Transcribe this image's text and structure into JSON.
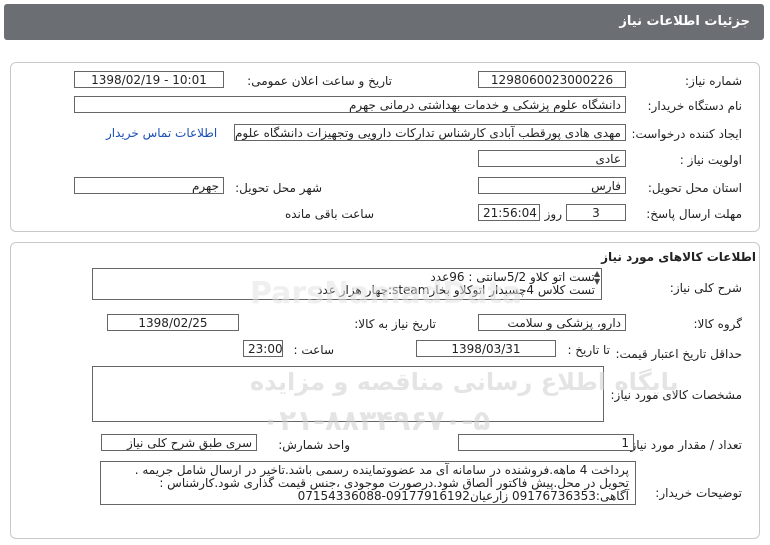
{
  "window_title": "جزئیات اطلاعات نیاز",
  "info": {
    "need_number_label": "شماره نیاز:",
    "need_number": "1298060023000226",
    "announce_label": "تاریخ و ساعت اعلان عمومی:",
    "announce_value": "1398/02/19 - 10:01",
    "buyer_label": "نام دستگاه خریدار:",
    "buyer_value": "دانشگاه علوم پزشکی و خدمات بهداشتی درمانی جهرم",
    "requester_label": "ایجاد کننده درخواست:",
    "requester_value": "مهدی هادی پورقطب آبادی کارشناس تدارکات دارویی وتجهیزات دانشگاه علوم پز",
    "contact_link": "اطلاعات تماس خریدار",
    "priority_label": "اولویت نیاز :",
    "priority_value": "عادی",
    "province_label": "استان محل تحویل:",
    "province_value": "فارس",
    "city_label": "شهر محل تحویل:",
    "city_value": "جهرم",
    "deadline_label": "مهلت ارسال پاسخ:",
    "deadline_days": "3",
    "days_word": "روز و",
    "deadline_time": "21:56:04",
    "remaining_text": "ساعت باقی مانده"
  },
  "goods": {
    "section_title": "اطلاعات کالاهای مورد نیاز",
    "desc_label": "شرح کلی نیاز:",
    "desc_lines": [
      "تست اتو کلاو 5/2سانتی :   96عدد",
      "تست کلاس 4چسبدار اتوکلاو بخارsteam:چهار هزار عدد"
    ],
    "group_label": "گروه کالا:",
    "group_value": "دارو، پزشکی و سلامت",
    "need_date_label": "تاریخ نیاز به کالا:",
    "need_date_value": "1398/02/25",
    "min_price_label": "حداقل تاریخ اعتبار قیمت:",
    "until_date_label": "تا تاریخ :",
    "until_date_value": "1398/03/31",
    "time_label": "ساعت :",
    "time_value": "23:00",
    "specs_label": "مشخصات کالای مورد نیاز:",
    "qty_label": "تعداد / مقدار مورد نیاز:",
    "qty_value": "1",
    "unit_label": "واحد شمارش:",
    "unit_value": "سری طبق شرح کلی نیاز",
    "notes_label": "توضیحات خریدار:",
    "notes_lines": [
      "پرداخت 4 ماهه.فروشنده در سامانه آی مد عضووتماینده رسمی باشد.تاخیر در ارسال شامل جریمه .",
      "تحویل در محل.پیش فاکتور الصاق شود.درصورت موجودی ،جنس قیمت گذاری شود.کارشناس :",
      "آگاهی:09176736353 زارعیان09177916192-07154336088"
    ]
  },
  "watermark": {
    "brand": "ParsNamadData",
    "line1": "پایگاه اطلاع رسانی مناقصه و مزایده",
    "line2": "۰۲۱-۸۸۳۴۹۶۷۰-۵"
  }
}
